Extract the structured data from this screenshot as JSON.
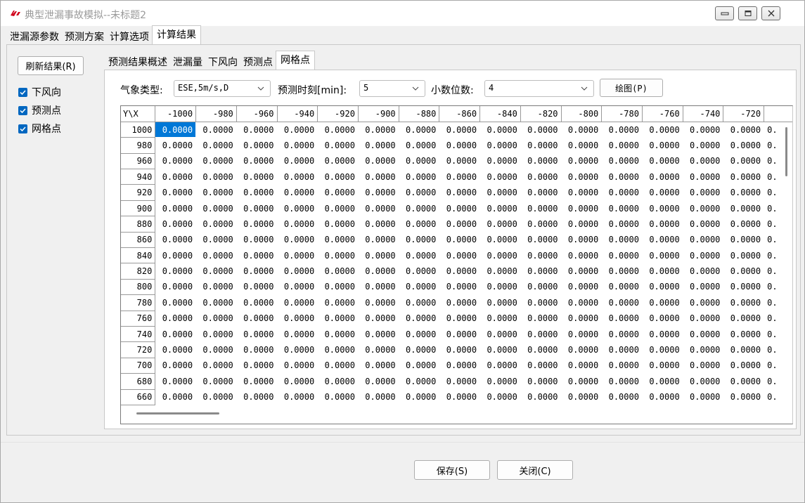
{
  "window": {
    "title": "典型泄漏事故模拟--未标题2",
    "minimize_icon": "minimize-icon",
    "maximize_icon": "maximize-icon",
    "close_icon": "close-icon"
  },
  "main_tabs": [
    {
      "label": "泄漏源参数"
    },
    {
      "label": "预测方案"
    },
    {
      "label": "计算选项"
    },
    {
      "label": "计算结果",
      "active": true
    }
  ],
  "sidebar": {
    "refresh_label": "刷新结果(R)",
    "checks": [
      {
        "label": "下风向",
        "checked": true
      },
      {
        "label": "预测点",
        "checked": true
      },
      {
        "label": "网格点",
        "checked": true
      }
    ]
  },
  "sub_tabs": [
    {
      "label": "预测结果概述"
    },
    {
      "label": "泄漏量"
    },
    {
      "label": "下风向"
    },
    {
      "label": "预测点"
    },
    {
      "label": "网格点",
      "active": true
    }
  ],
  "controls": {
    "weather_label": "气象类型:",
    "weather_value": "ESE,5m/s,D",
    "time_label": "预测时刻[min]:",
    "time_value": "5",
    "decimals_label": "小数位数:",
    "decimals_value": "4",
    "draw_label": "绘图(P)"
  },
  "grid": {
    "corner": "Y\\X",
    "columns": [
      "-1000",
      "-980",
      "-960",
      "-940",
      "-920",
      "-900",
      "-880",
      "-860",
      "-840",
      "-820",
      "-800",
      "-780",
      "-760",
      "-740",
      "-720"
    ],
    "rows": [
      "1000",
      "980",
      "960",
      "940",
      "920",
      "900",
      "880",
      "860",
      "840",
      "820",
      "800",
      "780",
      "760",
      "740",
      "720",
      "700",
      "680",
      "660"
    ],
    "cell_value": "0.0000",
    "truncated_cell": "0."
  },
  "buttons": {
    "save_label": "保存(S)",
    "close_label": "关闭(C)"
  },
  "colors": {
    "accent": "#0067c0",
    "selection": "#0078d7"
  }
}
